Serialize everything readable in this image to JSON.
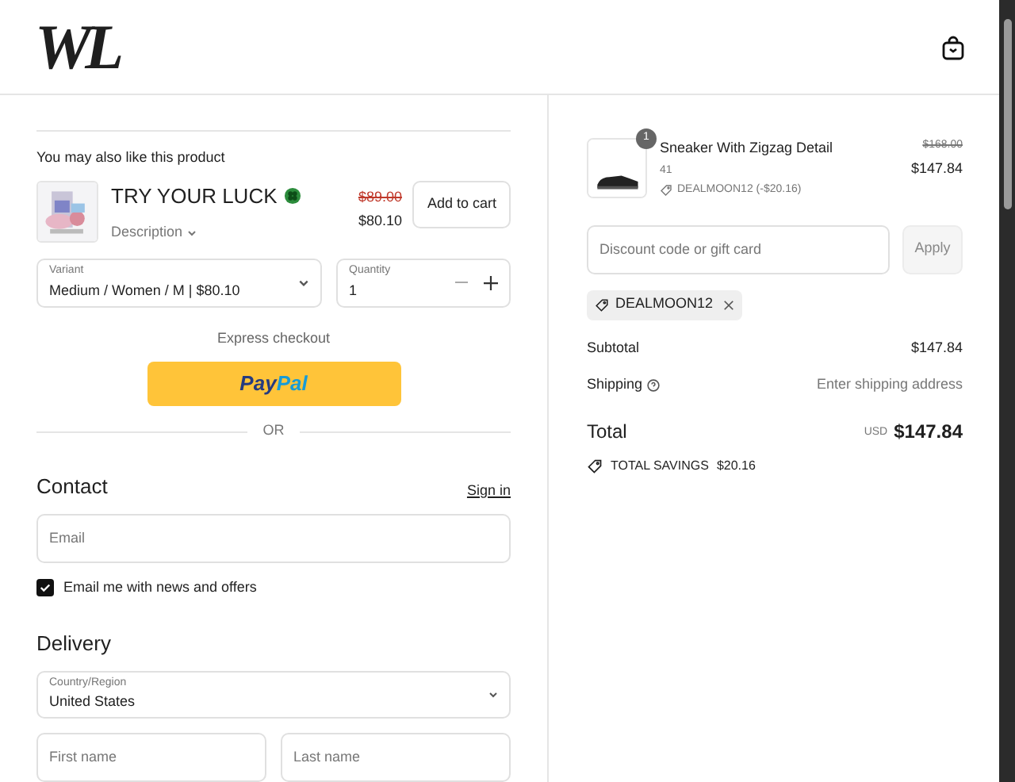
{
  "header": {
    "logo": "WL"
  },
  "upsell": {
    "heading": "You may also like this product",
    "title": "TRY YOUR LUCK",
    "description": "Description",
    "old_price": "$89.00",
    "price": "$80.10",
    "add_button": "Add to cart",
    "variant": {
      "label": "Variant",
      "value": "Medium / Women / M | $80.10"
    },
    "quantity": {
      "label": "Quantity",
      "value": "1"
    }
  },
  "express": {
    "label": "Express checkout",
    "paypal": [
      "Pay",
      "Pal"
    ],
    "or": "OR"
  },
  "contact": {
    "title": "Contact",
    "sign_in": "Sign in",
    "email_placeholder": "Email",
    "newsletter": {
      "label": "Email me with news and offers",
      "checked": true
    }
  },
  "delivery": {
    "title": "Delivery",
    "country": {
      "label": "Country/Region",
      "value": "United States"
    },
    "first_name_placeholder": "First name",
    "last_name_placeholder": "Last name"
  },
  "summary": {
    "item": {
      "quantity": "1",
      "name": "Sneaker With Zigzag Detail",
      "size": "41",
      "discount": "DEALMOON12 (-$20.16)",
      "old_price": "$168.00",
      "price": "$147.84"
    },
    "discount_placeholder": "Discount code or gift card",
    "apply": "Apply",
    "code": "DEALMOON12",
    "subtotal_label": "Subtotal",
    "subtotal": "$147.84",
    "shipping_label": "Shipping",
    "shipping": "Enter shipping address",
    "total_label": "Total",
    "currency": "USD",
    "total": "$147.84",
    "savings_label": "TOTAL SAVINGS",
    "savings": "$20.16"
  }
}
